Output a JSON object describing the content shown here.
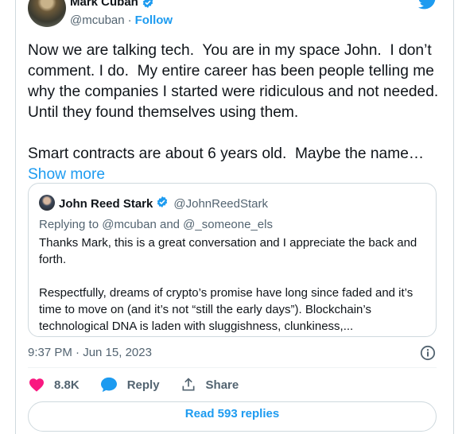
{
  "tweet": {
    "author_name": "Mark Cuban",
    "author_handle": "@mcuban",
    "separator": "·",
    "follow_label": "Follow",
    "text": "Now we are talking tech.  You are in my space John.  I don’t comment. I do.  My entire career has been people telling me why the companies I started were ridiculous and not needed.  Until they found themselves using them.\n\nSmart contracts are about 6 years old.  Maybe the name… ",
    "show_more_label": "Show more",
    "timestamp": "9:37 PM · Jun 15, 2023"
  },
  "quoted": {
    "author_name": "John Reed Stark",
    "author_handle": "@JohnReedStark",
    "replying_to": "Replying to @mcuban and @_someone_els",
    "text": "Thanks Mark, this is a great conversation and I appreciate the back and forth.\n\nRespectfully, dreams of crypto’s promise have long since faded and it’s time to move on (and it’s not “still the early days”). Blockchain’s technological DNA is laden with sluggishness, clunkiness,..."
  },
  "actions": {
    "like_count": "8.8K",
    "reply_label": "Reply",
    "share_label": "Share"
  },
  "read_replies_label": "Read 593 replies",
  "icons": [
    "verified-badge-icon",
    "twitter-bird-icon",
    "info-icon",
    "heart-icon",
    "reply-bubble-icon",
    "share-icon"
  ],
  "colors": {
    "accent": "#1d9bf0",
    "like": "#f91880",
    "text_secondary": "#536471",
    "border": "#cfd9de"
  }
}
